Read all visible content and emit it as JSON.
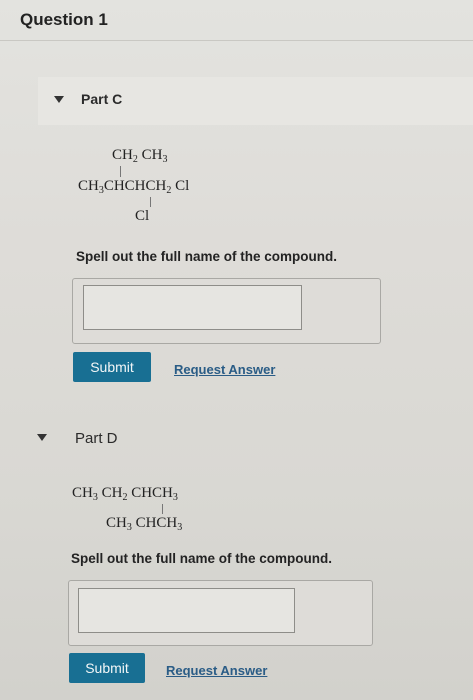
{
  "question": {
    "title": "Question 1"
  },
  "part_c": {
    "label": "Part C",
    "formula": {
      "top": [
        "CH",
        "2",
        " CH",
        "3"
      ],
      "main": [
        "CH",
        "3",
        "CHCHCH",
        "2",
        " Cl"
      ],
      "bottom": "Cl"
    },
    "prompt": "Spell out the full name of the compound.",
    "answer_value": "",
    "submit_label": "Submit",
    "request_label": "Request Answer"
  },
  "part_d": {
    "label": "Part D",
    "formula": {
      "main": [
        "CH",
        "3",
        " CH",
        "2",
        " CHCH",
        "3"
      ],
      "bottom": [
        "CH",
        "3",
        " CHCH",
        "3"
      ]
    },
    "prompt": "Spell out the full name of the compound.",
    "answer_value": "",
    "submit_label": "Submit",
    "request_label": "Request Answer"
  },
  "colors": {
    "submit_bg": "#186f93",
    "link": "#2a5c86"
  }
}
